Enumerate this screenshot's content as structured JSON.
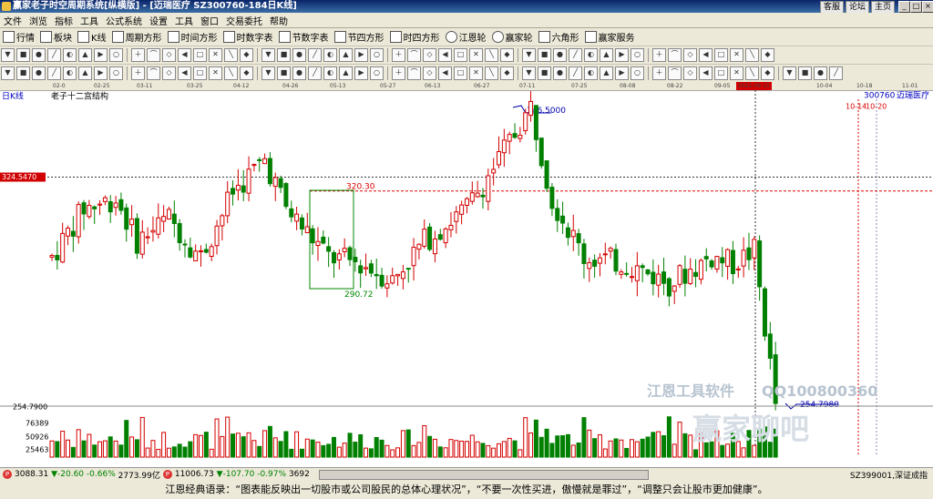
{
  "window": {
    "title": "赢家老子时空周期系统[纵横版] - [迈瑞医疗  SZ300760-184日K线]",
    "links": [
      "客服",
      "论坛",
      "主页"
    ],
    "win_btn_min": "_",
    "win_btn_restore": "□",
    "win_btn_close": "×"
  },
  "menu": [
    "文件",
    "浏览",
    "指标",
    "工具",
    "公式系统",
    "设置",
    "工具",
    "窗口",
    "交易委托",
    "帮助"
  ],
  "toolbar1": [
    "行情",
    "板块",
    "K线",
    "周期方形",
    "时间方形",
    "时数字表",
    "节数字表",
    "节四方形",
    "时四方形",
    "江恩轮",
    "赢家轮",
    "六角形",
    "赢家服务"
  ],
  "toolbar2_icons": [
    "arrow-icon",
    "binoculars-icon",
    "zoom-in-icon",
    "zoom-out-icon",
    "refresh-icon",
    "stop-icon",
    "right-arrow-icon",
    "info-icon",
    "cursor-icon",
    "diamond-icon"
  ],
  "toolbar3_icons": [
    "pointer-icon",
    "ruler-icon",
    "line-icon",
    "arrow-line-icon",
    "rect-icon",
    "circle-icon",
    "text-icon",
    "fib-icon",
    "gann-fan-icon",
    "cycle-icon"
  ],
  "top_axis": {
    "dates": [
      "02-0",
      "02-25",
      "03-11",
      "03-25",
      "04-12",
      "04-26",
      "05-13",
      "05-27",
      "06-13",
      "06-27",
      "07-11",
      "07-25",
      "08-08",
      "08-22",
      "09-05",
      "10-04",
      "10-18",
      "11-01"
    ],
    "highlight": "2022-09-15"
  },
  "chart": {
    "period_label": "日K线",
    "structure_label": "老子十二宫结构",
    "code": "300760",
    "name": "迈瑞医疗",
    "left_price_marker": "324.5470",
    "dates_marker": "10-14",
    "dates_marker2": "10-20",
    "watermark_brand": "江恩工具软件",
    "watermark_qq": "QQ100800360",
    "watermark_logo": "赢家聊吧"
  },
  "chart_data": {
    "type": "candlestick",
    "title": "老子十二宫结构",
    "annotations": {
      "high": "346.5000",
      "level1": "320.30",
      "level2": "290.72",
      "low": "254.7980",
      "bottom_price": "254.7900"
    },
    "volume_ticks": [
      "76389",
      "50926",
      "25463"
    ],
    "up_color": "#d40000",
    "down_color": "#008000"
  },
  "status": {
    "sh_index": "3088.31",
    "sh_change": "▼-20.60",
    "sh_pct": "-0.66%",
    "sh_amount": "2773.99亿",
    "sz_index": "11006.73",
    "sz_change": "▼-107.70",
    "sz_pct": "-0.97%",
    "sz_amount": "3692",
    "right_text": "SZ399001,深证成指",
    "icon_p": "P"
  },
  "quote": "江恩经典语录：“图表能反映出一切股市或公司股民的总体心理状况”，“不要一次性买进，傲慢就是罪过”，“调整只会让股市更加健康”。"
}
